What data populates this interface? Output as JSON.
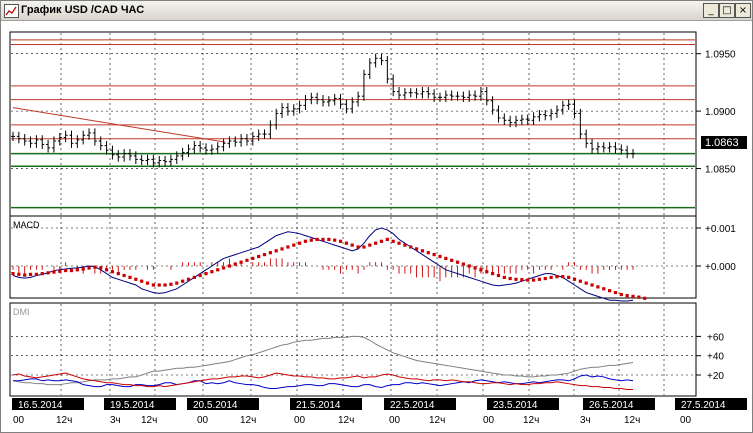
{
  "window": {
    "title": "График USD /CAD  ЧАС",
    "minimize": "_",
    "maximize": "□",
    "close": "×"
  },
  "price_panel": {
    "current_price": "1.0863",
    "y_ticks": [
      {
        "label": "1.0950",
        "value": 1.095
      },
      {
        "label": "1.0900",
        "value": 1.09
      },
      {
        "label": "1.0850",
        "value": 1.085
      }
    ],
    "horizontal_lines": [
      {
        "value": 1.0962,
        "color": "#c0392b"
      },
      {
        "value": 1.0958,
        "color": "#c0392b"
      },
      {
        "value": 1.0922,
        "color": "#c0392b"
      },
      {
        "value": 1.091,
        "color": "#c0392b"
      },
      {
        "value": 1.0888,
        "color": "#c0392b"
      },
      {
        "value": 1.0876,
        "color": "#c0392b"
      },
      {
        "value": 1.0863,
        "color": "#1a6b1a"
      },
      {
        "value": 1.0852,
        "color": "#1a6b1a"
      },
      {
        "value": 1.0816,
        "color": "#1a6b1a"
      }
    ],
    "trend_line": {
      "from": {
        "x": 0,
        "y": 1.0903
      },
      "to": {
        "x": 36.3,
        "y": 1.0873
      },
      "color": "#c0392b"
    },
    "closes": [
      1.0878,
      1.0876,
      1.0874,
      1.0872,
      1.0875,
      1.0871,
      1.0868,
      1.0874,
      1.0877,
      1.0879,
      1.0872,
      1.0875,
      1.0879,
      1.0881,
      1.0874,
      1.087,
      1.0866,
      1.0862,
      1.086,
      1.0863,
      1.0861,
      1.0858,
      1.0857,
      1.0858,
      1.0855,
      1.0857,
      1.0856,
      1.0858,
      1.0861,
      1.0864,
      1.0867,
      1.087,
      1.0868,
      1.0866,
      1.0867,
      1.0869,
      1.0872,
      1.0874,
      1.0873,
      1.0876,
      1.0874,
      1.0878,
      1.088,
      1.088,
      1.0888,
      1.0898,
      1.0903,
      1.09,
      1.0902,
      1.0905,
      1.091,
      1.0912,
      1.091,
      1.0908,
      1.0909,
      1.0911,
      1.0906,
      1.0902,
      1.0908,
      1.0913,
      1.0932,
      1.0942,
      1.0946,
      1.0944,
      1.0928,
      1.0917,
      1.0914,
      1.0916,
      1.0916,
      1.0915,
      1.0917,
      1.0915,
      1.0912,
      1.0912,
      1.0914,
      1.0913,
      1.0913,
      1.0912,
      1.0914,
      1.0913,
      1.0917,
      1.0909,
      1.0901,
      1.0894,
      1.0892,
      1.089,
      1.0892,
      1.0893,
      1.0892,
      1.0895,
      1.0897,
      1.0896,
      1.0898,
      1.0901,
      1.0905,
      1.0906,
      1.0898,
      1.088,
      1.0872,
      1.0867,
      1.0869,
      1.0868,
      1.0869,
      1.0867,
      1.0866,
      1.0863,
      1.0863
    ]
  },
  "macd_panel": {
    "label": "MACD",
    "y_ticks": [
      {
        "label": "+0.001",
        "value": 0.001
      },
      {
        "label": "+0.000",
        "value": 0.0
      }
    ],
    "histogram": [
      -0.0001,
      -0.0002,
      -0.0002,
      -0.0001,
      -0.0001,
      -0.0001,
      0.0,
      -0.0001,
      -0.0001,
      0.0001,
      0.0,
      -0.0001,
      -0.0002,
      -0.0001,
      -0.0002,
      -0.0002,
      -0.0001,
      -0.0001,
      -0.0002,
      -0.0001,
      -0.0001,
      -0.0001,
      0.0,
      -0.0001,
      -0.0001,
      0.0,
      0.0,
      -0.0001,
      0.0,
      0.0001,
      0.0001,
      0.0001,
      0.0001,
      0.0,
      0.0001,
      0.0001,
      0.0001,
      0.0002,
      0.0001,
      0.0001,
      0.0,
      0.0001,
      0.0001,
      0.0001,
      0.0002,
      0.0002,
      0.0002,
      0.0001,
      0.0001,
      0.0001,
      0.0001,
      0.0,
      0.0,
      -0.0001,
      -0.0001,
      -0.0001,
      -0.0002,
      -0.0001,
      -0.0001,
      -0.0002,
      -0.0001,
      0.0001,
      0.0001,
      0.0001,
      -0.0001,
      -0.0001,
      -0.0002,
      -0.0002,
      -0.0002,
      -0.0003,
      -0.0003,
      -0.0003,
      -0.0003,
      -0.0004,
      -0.0003,
      -0.0003,
      -0.0003,
      -0.0003,
      -0.0002,
      -0.0003,
      -0.0002,
      -0.0002,
      -0.0002,
      -0.0002,
      -0.0002,
      -0.0002,
      -0.0002,
      -0.0001,
      -0.0001,
      -0.0002,
      -0.0001,
      -0.0001,
      -0.0001,
      0.0,
      -0.0001,
      0.0001,
      0.0001,
      -0.0001,
      -0.0001,
      -0.0002,
      -0.0002,
      -0.0001,
      -0.0001,
      -0.0001,
      -0.0001,
      -0.0001,
      -0.0001
    ],
    "signal": [
      -0.0002,
      -0.00022,
      -0.00024,
      -0.00022,
      -0.00022,
      -0.0002,
      -0.00018,
      -0.00016,
      -0.00014,
      -0.00012,
      -0.00012,
      -0.0001,
      -8e-05,
      -5e-05,
      -3e-05,
      -5e-05,
      -0.0001,
      -0.00015,
      -0.0002,
      -0.00025,
      -0.0003,
      -0.00035,
      -0.0004,
      -0.00045,
      -0.0005,
      -0.0005,
      -0.0005,
      -0.00048,
      -0.00045,
      -0.0004,
      -0.00035,
      -0.0003,
      -0.00025,
      -0.0002,
      -0.00015,
      -0.0001,
      -5e-05,
      0.0,
      5e-05,
      0.0001,
      0.00015,
      0.0002,
      0.00025,
      0.0003,
      0.00035,
      0.0004,
      0.00045,
      0.0005,
      0.00055,
      0.0006,
      0.00065,
      0.00068,
      0.0007,
      0.0007,
      0.0007,
      0.00068,
      0.00065,
      0.0006,
      0.00055,
      0.0005,
      0.0005,
      0.00055,
      0.0006,
      0.00065,
      0.0007,
      0.00065,
      0.0006,
      0.00055,
      0.0005,
      0.00045,
      0.0004,
      0.00035,
      0.0003,
      0.00025,
      0.0002,
      0.00015,
      0.0001,
      5e-05,
      0.0,
      -5e-05,
      -0.0001,
      -0.00015,
      -0.0002,
      -0.00025,
      -0.0003,
      -0.00033,
      -0.00035,
      -0.00036,
      -0.00037,
      -0.00037,
      -0.00035,
      -0.00033,
      -0.0003,
      -0.00028,
      -0.00028,
      -0.0003,
      -0.00035,
      -0.0004,
      -0.00045,
      -0.0005,
      -0.00055,
      -0.0006,
      -0.00065,
      -0.0007,
      -0.00075,
      -0.00078,
      -0.0008,
      -0.00082,
      -0.00085
    ],
    "macd": [
      -0.00025,
      -0.0003,
      -0.00032,
      -0.0003,
      -0.00025,
      -0.00022,
      -0.00018,
      -0.00012,
      -0.0001,
      -8e-05,
      -6e-05,
      -5e-05,
      -3e-05,
      0.0,
      -2e-05,
      -0.0001,
      -0.0002,
      -0.0003,
      -0.00035,
      -0.0004,
      -0.00045,
      -0.0005,
      -0.0006,
      -0.00065,
      -0.0007,
      -0.00072,
      -0.0007,
      -0.00065,
      -0.0006,
      -0.0005,
      -0.0004,
      -0.0003,
      -0.0002,
      -0.0001,
      0.0,
      0.0001,
      0.0002,
      0.00025,
      0.0003,
      0.00035,
      0.0004,
      0.00045,
      0.0005,
      0.0006,
      0.0007,
      0.0008,
      0.00085,
      0.0009,
      0.00088,
      0.00085,
      0.0008,
      0.00075,
      0.0007,
      0.00065,
      0.0006,
      0.00055,
      0.0005,
      0.00045,
      0.0004,
      0.00045,
      0.0006,
      0.0008,
      0.00095,
      0.001,
      0.00095,
      0.00085,
      0.0007,
      0.0006,
      0.0005,
      0.0004,
      0.0003,
      0.0002,
      0.0001,
      0.0,
      -0.0001,
      -0.00015,
      -0.0002,
      -0.00025,
      -0.0003,
      -0.00035,
      -0.0004,
      -0.00045,
      -0.0005,
      -0.00052,
      -0.0005,
      -0.00048,
      -0.00045,
      -0.0004,
      -0.00035,
      -0.0003,
      -0.00025,
      -0.0002,
      -0.0002,
      -0.00025,
      -0.0003,
      -0.0004,
      -0.0005,
      -0.0006,
      -0.0007,
      -0.00075,
      -0.0008,
      -0.00085,
      -0.0009,
      -0.0009,
      -0.00092,
      -0.00092,
      -0.0009
    ]
  },
  "dmi_panel": {
    "label": "DMI",
    "y_ticks": [
      {
        "label": "+60",
        "value": 60
      },
      {
        "label": "+40",
        "value": 40
      },
      {
        "label": "+20",
        "value": 20
      }
    ],
    "adx": [
      14,
      13,
      12,
      12,
      11,
      11,
      10,
      10,
      10,
      11,
      12,
      12,
      13,
      14,
      15,
      15,
      15,
      16,
      16,
      17,
      18,
      18,
      20,
      22,
      24,
      24,
      25,
      26,
      27,
      27,
      28,
      28,
      29,
      30,
      31,
      32,
      33,
      34,
      36,
      38,
      40,
      41,
      43,
      45,
      47,
      49,
      51,
      52,
      54,
      55,
      56,
      56,
      57,
      58,
      58,
      59,
      59,
      59,
      60,
      60,
      59,
      56,
      52,
      49,
      46,
      43,
      41,
      39,
      37,
      35,
      34,
      33,
      32,
      31,
      30,
      29,
      28,
      27,
      26,
      25,
      24,
      23,
      22,
      21,
      20,
      20,
      19,
      19,
      18,
      18,
      19,
      19,
      20,
      20,
      21,
      22,
      24,
      26,
      27,
      28,
      28,
      29,
      30,
      30,
      31,
      32,
      33
    ],
    "plus_di": [
      14,
      14,
      15,
      16,
      16,
      14,
      15,
      14,
      14,
      15,
      14,
      13,
      10,
      9,
      8,
      8,
      10,
      10,
      9,
      8,
      8,
      10,
      10,
      9,
      9,
      10,
      12,
      12,
      10,
      11,
      12,
      14,
      14,
      11,
      12,
      11,
      12,
      14,
      12,
      11,
      10,
      10,
      9,
      7,
      6,
      6,
      7,
      8,
      8,
      9,
      10,
      10,
      9,
      9,
      11,
      11,
      10,
      9,
      8,
      8,
      10,
      10,
      8,
      7,
      9,
      10,
      10,
      12,
      12,
      11,
      12,
      11,
      10,
      9,
      10,
      11,
      12,
      13,
      12,
      14,
      15,
      14,
      13,
      12,
      13,
      12,
      11,
      11,
      12,
      13,
      12,
      13,
      14,
      15,
      15,
      14,
      16,
      19,
      20,
      18,
      19,
      18,
      16,
      15,
      14,
      15,
      14
    ],
    "minus_di": [
      20,
      21,
      19,
      18,
      17,
      18,
      19,
      20,
      21,
      22,
      20,
      18,
      16,
      15,
      14,
      13,
      12,
      12,
      11,
      10,
      10,
      9,
      9,
      8,
      8,
      9,
      8,
      9,
      10,
      11,
      12,
      13,
      14,
      15,
      16,
      16,
      17,
      18,
      18,
      19,
      19,
      18,
      17,
      18,
      20,
      22,
      21,
      20,
      19,
      19,
      18,
      18,
      17,
      17,
      16,
      16,
      17,
      17,
      18,
      19,
      17,
      18,
      18,
      20,
      21,
      20,
      18,
      17,
      16,
      16,
      15,
      14,
      15,
      15,
      14,
      15,
      14,
      13,
      13,
      12,
      11,
      11,
      12,
      12,
      11,
      10,
      11,
      10,
      10,
      11,
      11,
      12,
      12,
      13,
      12,
      11,
      10,
      9,
      9,
      8,
      8,
      7,
      7,
      6,
      6,
      5,
      5
    ]
  },
  "time_axis": {
    "dates": [
      "16.5.2014",
      "19.5.2014",
      "20.5.2014",
      "21.5.2014",
      "22.5.2014",
      "23.5.2014",
      "26.5.2014",
      "27.5.2014"
    ],
    "hour_labels": [
      "00",
      "12ч",
      "3ч",
      "12ч",
      "00",
      "12ч",
      "00",
      "12ч",
      "00",
      "12ч",
      "00",
      "12ч",
      "3ч",
      "12ч",
      "00"
    ]
  },
  "colors": {
    "price_bar": "#000000",
    "resistance": "#c0392b",
    "support": "#1a6b1a",
    "macd": "#000080",
    "signal": "#cc0000",
    "histogram": "#cc0000",
    "adx": "#808080",
    "plus_di": "#0000cc",
    "minus_di": "#cc0000",
    "grid": "#000000"
  }
}
